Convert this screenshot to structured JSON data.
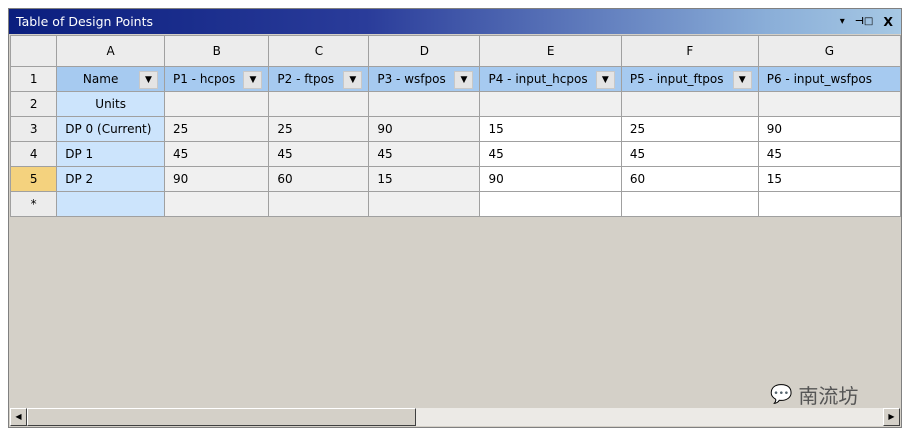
{
  "window": {
    "title": "Table of Design Points",
    "controls": [
      "▾",
      "⊣□",
      "X"
    ]
  },
  "columns": [
    "A",
    "B",
    "C",
    "D",
    "E",
    "F",
    "G"
  ],
  "rows": [
    {
      "num": "1",
      "cells": [
        "Name",
        "P1 - hcpos",
        "P2 - ftpos",
        "P3 - wsfpos",
        "P4 - input_hcpos",
        "P5 - input_ftpos",
        "P6 - input_wsfpos"
      ]
    },
    {
      "num": "2",
      "cells": [
        "Units",
        "",
        "",
        "",
        "",
        "",
        ""
      ]
    },
    {
      "num": "3",
      "cells": [
        "DP 0 (Current)",
        "25",
        "25",
        "90",
        "15",
        "25",
        "90"
      ]
    },
    {
      "num": "4",
      "cells": [
        "DP 1",
        "45",
        "45",
        "45",
        "45",
        "45",
        "45"
      ]
    },
    {
      "num": "5",
      "cells": [
        "DP 2",
        "90",
        "60",
        "15",
        "90",
        "60",
        "15"
      ]
    },
    {
      "num": "*",
      "cells": [
        "",
        "",
        "",
        "",
        "",
        "",
        ""
      ]
    }
  ],
  "scrollbar": {
    "left": "◀",
    "right": "▶"
  },
  "watermark": "南流坊"
}
